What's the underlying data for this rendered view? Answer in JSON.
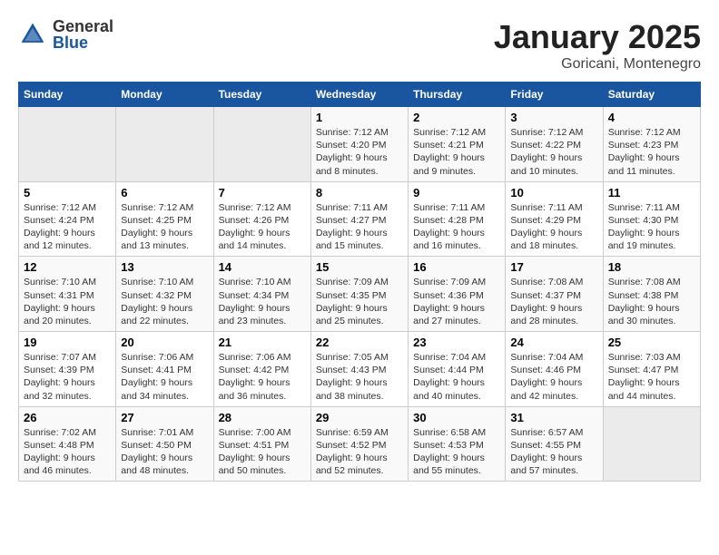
{
  "logo": {
    "general": "General",
    "blue": "Blue"
  },
  "title": "January 2025",
  "subtitle": "Goricani, Montenegro",
  "days_header": [
    "Sunday",
    "Monday",
    "Tuesday",
    "Wednesday",
    "Thursday",
    "Friday",
    "Saturday"
  ],
  "weeks": [
    [
      {
        "day": "",
        "content": ""
      },
      {
        "day": "",
        "content": ""
      },
      {
        "day": "",
        "content": ""
      },
      {
        "day": "1",
        "content": "Sunrise: 7:12 AM\nSunset: 4:20 PM\nDaylight: 9 hours and 8 minutes."
      },
      {
        "day": "2",
        "content": "Sunrise: 7:12 AM\nSunset: 4:21 PM\nDaylight: 9 hours and 9 minutes."
      },
      {
        "day": "3",
        "content": "Sunrise: 7:12 AM\nSunset: 4:22 PM\nDaylight: 9 hours and 10 minutes."
      },
      {
        "day": "4",
        "content": "Sunrise: 7:12 AM\nSunset: 4:23 PM\nDaylight: 9 hours and 11 minutes."
      }
    ],
    [
      {
        "day": "5",
        "content": "Sunrise: 7:12 AM\nSunset: 4:24 PM\nDaylight: 9 hours and 12 minutes."
      },
      {
        "day": "6",
        "content": "Sunrise: 7:12 AM\nSunset: 4:25 PM\nDaylight: 9 hours and 13 minutes."
      },
      {
        "day": "7",
        "content": "Sunrise: 7:12 AM\nSunset: 4:26 PM\nDaylight: 9 hours and 14 minutes."
      },
      {
        "day": "8",
        "content": "Sunrise: 7:11 AM\nSunset: 4:27 PM\nDaylight: 9 hours and 15 minutes."
      },
      {
        "day": "9",
        "content": "Sunrise: 7:11 AM\nSunset: 4:28 PM\nDaylight: 9 hours and 16 minutes."
      },
      {
        "day": "10",
        "content": "Sunrise: 7:11 AM\nSunset: 4:29 PM\nDaylight: 9 hours and 18 minutes."
      },
      {
        "day": "11",
        "content": "Sunrise: 7:11 AM\nSunset: 4:30 PM\nDaylight: 9 hours and 19 minutes."
      }
    ],
    [
      {
        "day": "12",
        "content": "Sunrise: 7:10 AM\nSunset: 4:31 PM\nDaylight: 9 hours and 20 minutes."
      },
      {
        "day": "13",
        "content": "Sunrise: 7:10 AM\nSunset: 4:32 PM\nDaylight: 9 hours and 22 minutes."
      },
      {
        "day": "14",
        "content": "Sunrise: 7:10 AM\nSunset: 4:34 PM\nDaylight: 9 hours and 23 minutes."
      },
      {
        "day": "15",
        "content": "Sunrise: 7:09 AM\nSunset: 4:35 PM\nDaylight: 9 hours and 25 minutes."
      },
      {
        "day": "16",
        "content": "Sunrise: 7:09 AM\nSunset: 4:36 PM\nDaylight: 9 hours and 27 minutes."
      },
      {
        "day": "17",
        "content": "Sunrise: 7:08 AM\nSunset: 4:37 PM\nDaylight: 9 hours and 28 minutes."
      },
      {
        "day": "18",
        "content": "Sunrise: 7:08 AM\nSunset: 4:38 PM\nDaylight: 9 hours and 30 minutes."
      }
    ],
    [
      {
        "day": "19",
        "content": "Sunrise: 7:07 AM\nSunset: 4:39 PM\nDaylight: 9 hours and 32 minutes."
      },
      {
        "day": "20",
        "content": "Sunrise: 7:06 AM\nSunset: 4:41 PM\nDaylight: 9 hours and 34 minutes."
      },
      {
        "day": "21",
        "content": "Sunrise: 7:06 AM\nSunset: 4:42 PM\nDaylight: 9 hours and 36 minutes."
      },
      {
        "day": "22",
        "content": "Sunrise: 7:05 AM\nSunset: 4:43 PM\nDaylight: 9 hours and 38 minutes."
      },
      {
        "day": "23",
        "content": "Sunrise: 7:04 AM\nSunset: 4:44 PM\nDaylight: 9 hours and 40 minutes."
      },
      {
        "day": "24",
        "content": "Sunrise: 7:04 AM\nSunset: 4:46 PM\nDaylight: 9 hours and 42 minutes."
      },
      {
        "day": "25",
        "content": "Sunrise: 7:03 AM\nSunset: 4:47 PM\nDaylight: 9 hours and 44 minutes."
      }
    ],
    [
      {
        "day": "26",
        "content": "Sunrise: 7:02 AM\nSunset: 4:48 PM\nDaylight: 9 hours and 46 minutes."
      },
      {
        "day": "27",
        "content": "Sunrise: 7:01 AM\nSunset: 4:50 PM\nDaylight: 9 hours and 48 minutes."
      },
      {
        "day": "28",
        "content": "Sunrise: 7:00 AM\nSunset: 4:51 PM\nDaylight: 9 hours and 50 minutes."
      },
      {
        "day": "29",
        "content": "Sunrise: 6:59 AM\nSunset: 4:52 PM\nDaylight: 9 hours and 52 minutes."
      },
      {
        "day": "30",
        "content": "Sunrise: 6:58 AM\nSunset: 4:53 PM\nDaylight: 9 hours and 55 minutes."
      },
      {
        "day": "31",
        "content": "Sunrise: 6:57 AM\nSunset: 4:55 PM\nDaylight: 9 hours and 57 minutes."
      },
      {
        "day": "",
        "content": ""
      }
    ]
  ]
}
